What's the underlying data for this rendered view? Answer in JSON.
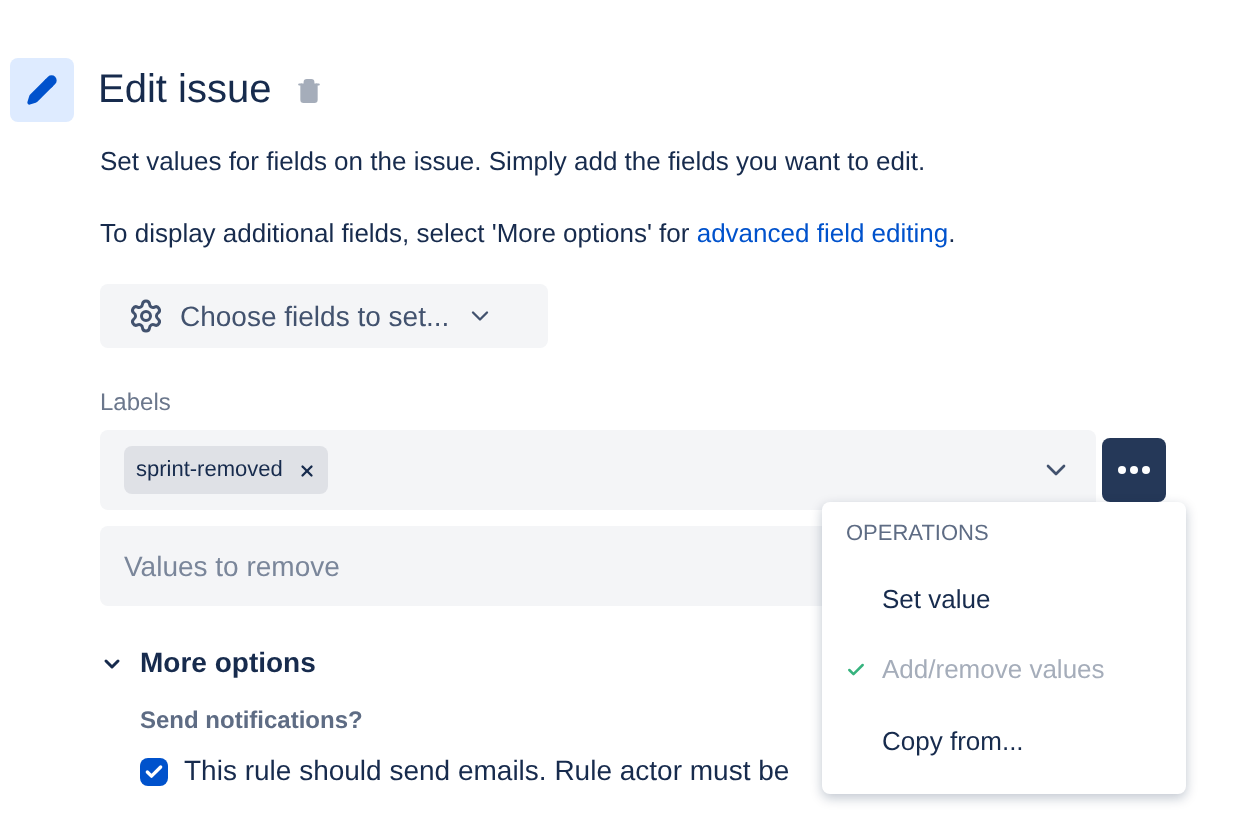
{
  "header": {
    "title": "Edit issue"
  },
  "description": [
    "Set values for fields on the issue. Simply add the fields you want to edit."
  ],
  "more_info": {
    "text": "To display additional fields, select 'More options' for ",
    "link": "advanced field editing",
    "after": "."
  },
  "choose_button": {
    "label": "Choose fields to set..."
  },
  "labels_field": {
    "label": "Labels",
    "tags": [
      {
        "text": "sprint-removed"
      }
    ]
  },
  "remove_field": {
    "placeholder": "Values to remove"
  },
  "operations_menu": {
    "heading": "OPERATIONS",
    "items": [
      {
        "label": "Set value",
        "selected": false
      },
      {
        "label": "Add/remove values",
        "selected": true
      },
      {
        "label": "Copy from...",
        "selected": false
      }
    ]
  },
  "more_options": {
    "label": "More options",
    "expanded": true,
    "send_notifications": {
      "label": "Send notifications?",
      "checked": true,
      "text": "This rule should send emails. Rule actor must be"
    }
  }
}
